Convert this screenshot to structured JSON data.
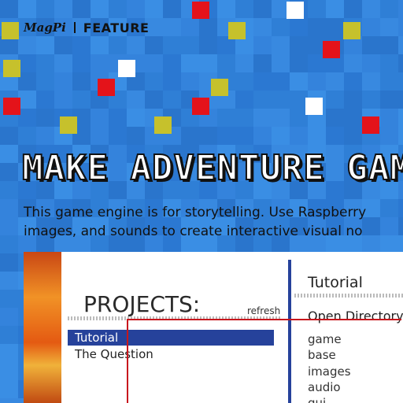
{
  "masthead": {
    "logo": "MagPi",
    "section": "FEATURE"
  },
  "article": {
    "headline": "MAKE ADVENTURE GAM",
    "standfirst": [
      "This game engine is for storytelling. Use Raspberry",
      "images, and sounds to create interactive visual no"
    ]
  },
  "screenshot": {
    "projects_title": "PROJECTS:",
    "refresh_label": "refresh",
    "projects": [
      {
        "label": "Tutorial",
        "selected": true
      },
      {
        "label": "The Question",
        "selected": false
      }
    ],
    "right_title": "Tutorial",
    "open_directory": "Open Directory",
    "folders": [
      "game",
      "base",
      "images",
      "audio",
      "gui"
    ]
  },
  "colors": {
    "background": "#2f7fd6",
    "selection": "#26429b",
    "annotation_line": "#c8171d",
    "pixel_red": "#e4131a",
    "pixel_yellow": "#c6c12c",
    "pixel_white": "#ffffff"
  }
}
